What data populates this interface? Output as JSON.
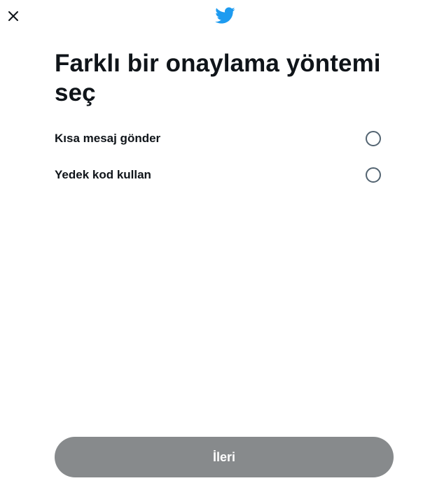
{
  "header": {
    "close_icon": "close-icon",
    "logo_icon": "twitter-bird-icon",
    "logo_color": "#1d9bf0"
  },
  "main": {
    "title": "Farklı bir onaylama yöntemi seç",
    "options": [
      {
        "label": "Kısa mesaj gönder",
        "selected": false
      },
      {
        "label": "Yedek kod kullan",
        "selected": false
      }
    ]
  },
  "footer": {
    "next_label": "İleri",
    "next_button_color": "#878a8c"
  }
}
